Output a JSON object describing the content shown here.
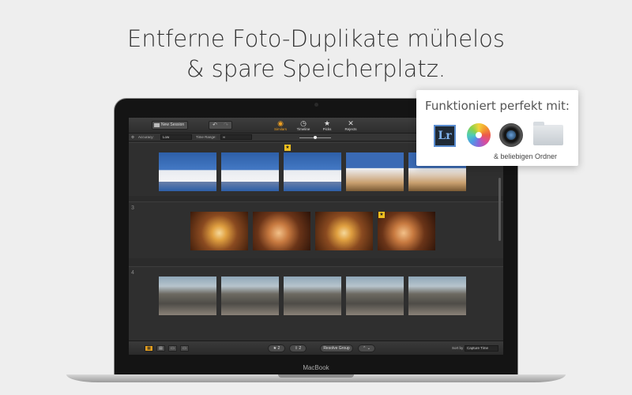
{
  "headline": {
    "line1": "Entferne Foto-Duplikate mühelos",
    "line2": "& spare Speicherplatz."
  },
  "device": {
    "brand": "MacBook"
  },
  "app": {
    "toolbar": {
      "new_session": "New Session",
      "undo_glyph": "↶",
      "redo_glyph": "↷",
      "tools": [
        {
          "label": "Similars",
          "glyph": "◉",
          "active": true
        },
        {
          "label": "Timeline",
          "glyph": "◷",
          "active": false
        },
        {
          "label": "Picks",
          "glyph": "★",
          "active": false
        },
        {
          "label": "Rejects",
          "glyph": "✕",
          "active": false
        }
      ]
    },
    "options": {
      "accuracy_label": "Accuracy:",
      "accuracy_value": "Low",
      "time_range_label": "Time Range:",
      "time_range_value": "∞"
    },
    "groups": [
      {
        "number": "",
        "icons": "kittens",
        "badge_index": 2
      },
      {
        "number": "3",
        "icons": "food",
        "badge_index": 3
      },
      {
        "number": "4",
        "icons": "street",
        "badge_index": -1
      }
    ],
    "bottom": {
      "picks_count": "2",
      "export_count": "2",
      "resolve_group": "Resolve Group",
      "sort_by_label": "Sort by",
      "sort_by_value": "Capture Time"
    }
  },
  "popup": {
    "title": "Funktioniert perfekt mit:",
    "lightroom": "Lr",
    "subtitle": "& beliebigen Ordner",
    "icons": [
      "lightroom-icon",
      "photos-icon",
      "aperture-icon",
      "folder-icon"
    ]
  }
}
